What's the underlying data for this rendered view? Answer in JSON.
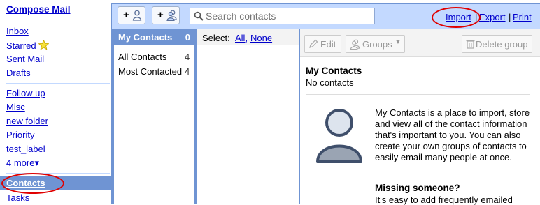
{
  "leftnav": {
    "compose": "Compose Mail",
    "items": [
      "Inbox",
      "Starred",
      "Sent Mail",
      "Drafts"
    ],
    "labels": [
      "Follow up",
      "Misc",
      "new folder",
      "Priority",
      "test_label",
      "4 more▾"
    ],
    "contacts": "Contacts",
    "tasks": "Tasks"
  },
  "toolbar": {
    "search_placeholder": "Search contacts",
    "import": "Import",
    "export": "Export",
    "print": "Print",
    "sep": "|"
  },
  "groups": {
    "header": "My Contacts",
    "header_count": "0",
    "rows": [
      {
        "label": "All Contacts",
        "count": "4"
      },
      {
        "label": "Most Contacted",
        "count": "4"
      }
    ]
  },
  "clist": {
    "select": "Select:",
    "all": "All,",
    "none": "None"
  },
  "detail": {
    "edit": "Edit",
    "groups": "Groups",
    "delete": "Delete group",
    "title": "My Contacts",
    "subtitle": "No contacts",
    "intro": "My Contacts is a place to import, store and view all of the contact information that's important to you. You can also create your own groups of contacts to easily email many people at once.",
    "missing": "Missing someone?",
    "easy": "It's easy to add frequently emailed"
  },
  "colors": {
    "accent": "#6f94d3",
    "toolbar": "#c3d9ff",
    "link": "#0000cc",
    "highlight_oval": "#e00000"
  }
}
